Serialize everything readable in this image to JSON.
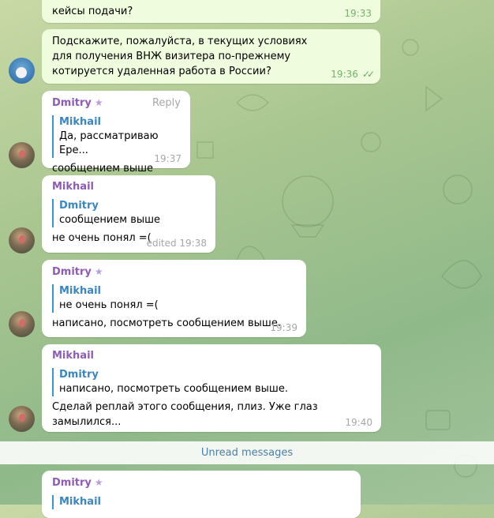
{
  "messages": [
    {
      "text": "кейсы подачи?",
      "time": "19:33"
    },
    {
      "text": "Подскажите, пожалуйста, в текущих условиях для получения ВНЖ визитера по-прежнему котируется удаленная работа в России?",
      "time": "19:36",
      "checks": "✓✓"
    },
    {
      "sender": "Dmitry",
      "badge": "★",
      "action": "Reply",
      "quote_name": "Mikhail",
      "quote_text": "Да, рассматриваю Ере...",
      "text": "сообщением выше",
      "time": "19:37"
    },
    {
      "sender": "Mikhail",
      "quote_name": "Dmitry",
      "quote_text": "сообщением выше",
      "text": "не очень понял =(",
      "time": "edited 19:38"
    },
    {
      "sender": "Dmitry",
      "badge": "★",
      "quote_name": "Mikhail",
      "quote_text": "не очень понял =(",
      "text": "написано, посмотреть сообщением выше.",
      "time": "19:39"
    },
    {
      "sender": "Mikhail",
      "quote_name": "Dmitry",
      "quote_text": "написано, посмотреть сообщением выше.",
      "text": "Сделай реплай этого сообщения, плиз. Уже глаз замылился...",
      "time": "19:40"
    },
    {
      "sender": "Dmitry",
      "badge": "★",
      "quote_name": "Mikhail"
    }
  ],
  "unread_label": "Unread messages"
}
